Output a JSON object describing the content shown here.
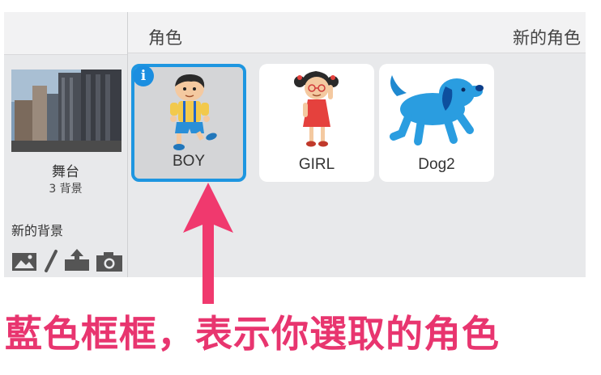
{
  "stage": {
    "label": "舞台",
    "backdrop_count": "3 背景",
    "new_backdrop_label": "新的背景",
    "tools": [
      "paint-backdrop-icon",
      "draw-backdrop-icon",
      "upload-backdrop-icon",
      "camera-backdrop-icon"
    ]
  },
  "sprites": {
    "title": "角色",
    "new_sprite_label": "新的角色",
    "items": [
      {
        "name": "BOY",
        "selected": true,
        "info_icon": "i"
      },
      {
        "name": "GIRL",
        "selected": false
      },
      {
        "name": "Dog2",
        "selected": false
      }
    ]
  },
  "annotation": {
    "caption": "藍色框框，表示你選取的角色",
    "color": "#e8356f"
  },
  "colors": {
    "selection_border": "#1e96e0",
    "panel_bg": "#e8e9eb"
  }
}
